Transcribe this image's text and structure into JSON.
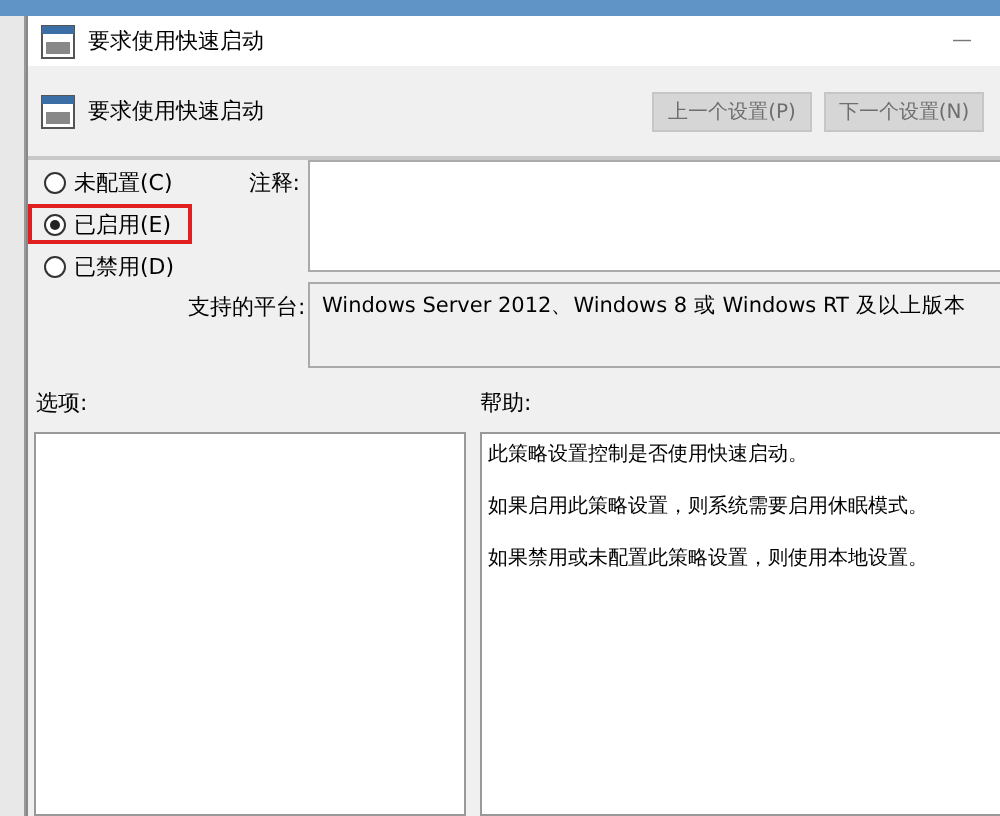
{
  "window": {
    "title": "要求使用快速启动",
    "minimize": "—"
  },
  "header": {
    "title": "要求使用快速启动",
    "buttons": [
      {
        "label": "上一个设置(P)",
        "disabled": true
      },
      {
        "label": "下一个设置(N)",
        "disabled": true
      }
    ]
  },
  "options": [
    {
      "label": "未配置(C)",
      "selected": false,
      "highlighted": false
    },
    {
      "label": "已启用(E)",
      "selected": true,
      "highlighted": true
    },
    {
      "label": "已禁用(D)",
      "selected": false,
      "highlighted": false
    }
  ],
  "comment": {
    "label": "注释:"
  },
  "platform": {
    "label": "支持的平台:",
    "value": "Windows Server 2012、Windows 8 或 Windows RT 及以上版本"
  },
  "options_pane": {
    "label": "选项:"
  },
  "help_pane": {
    "label": "帮助:",
    "paragraphs": [
      "此策略设置控制是否使用快速启动。",
      "如果启用此策略设置，则系统需要启用休眠模式。",
      "如果禁用或未配置此策略设置，则使用本地设置。"
    ]
  }
}
